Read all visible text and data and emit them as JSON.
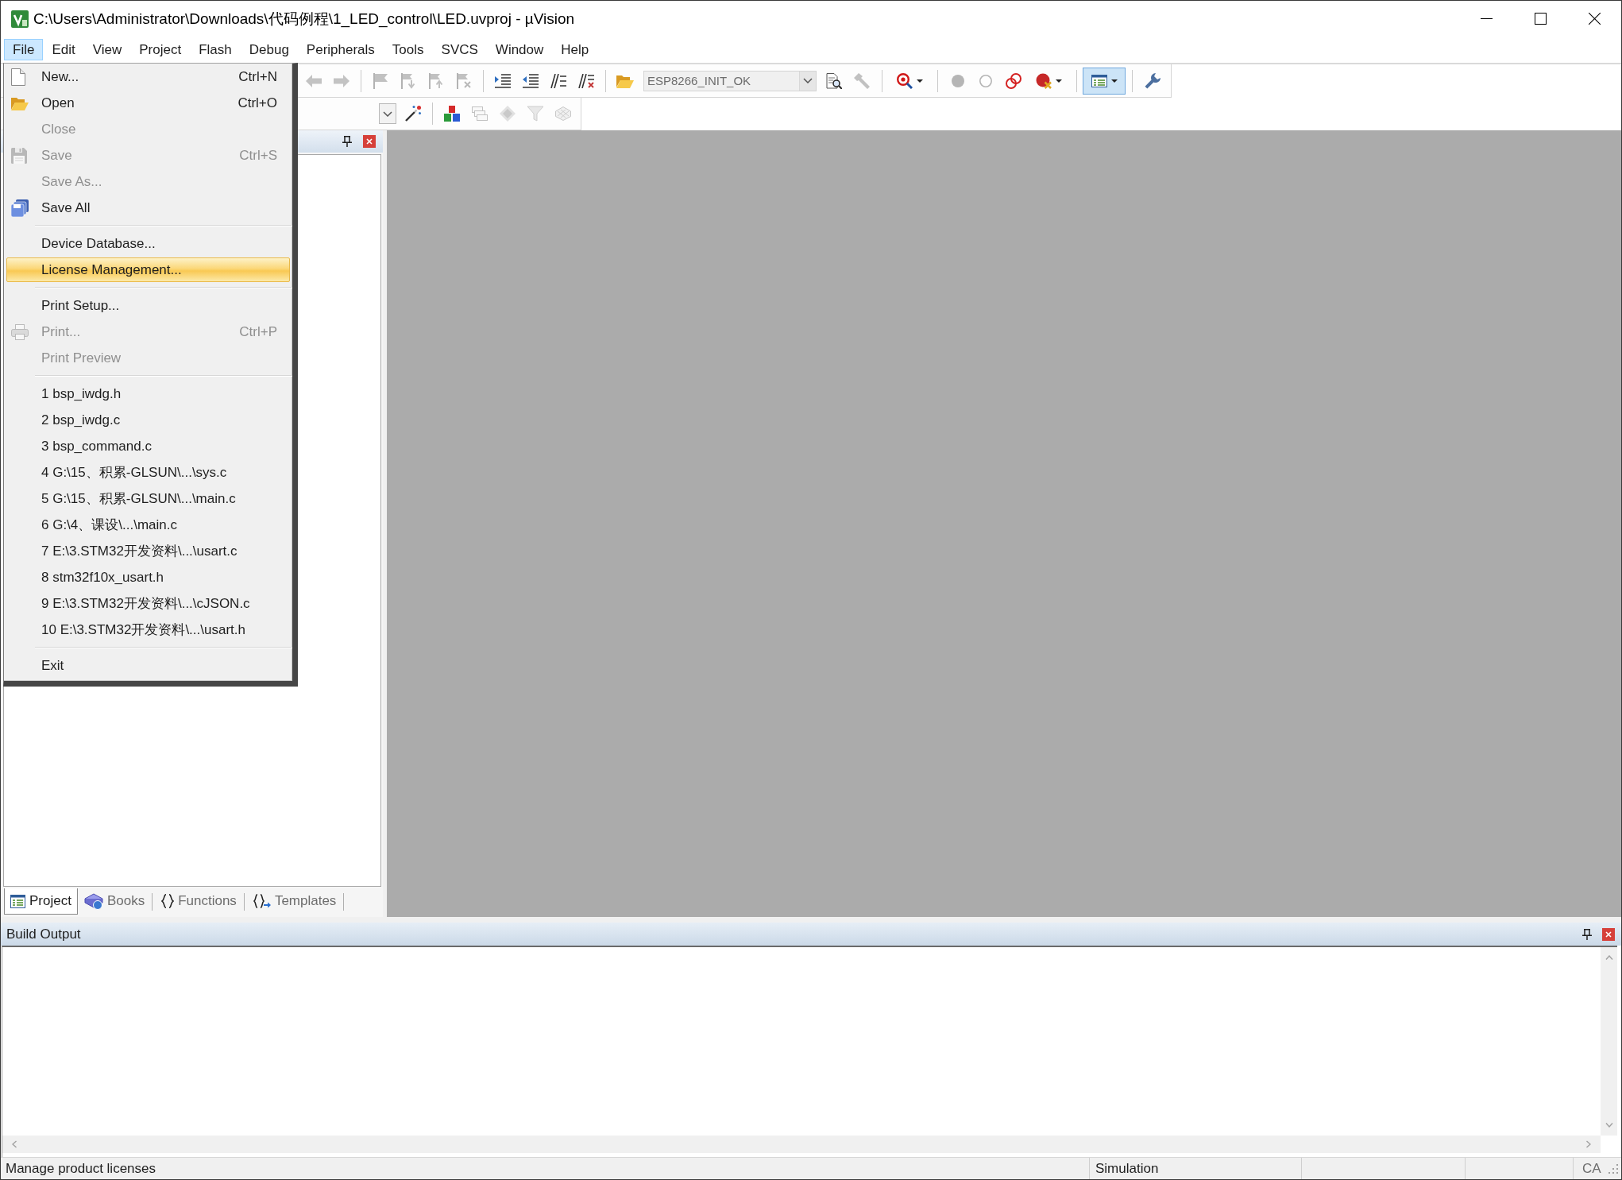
{
  "window": {
    "title": "C:\\Users\\Administrator\\Downloads\\代码例程\\1_LED_control\\LED.uvproj - µVision"
  },
  "menu_bar": [
    {
      "label": "File",
      "selected": true
    },
    {
      "label": "Edit",
      "selected": false
    },
    {
      "label": "View",
      "selected": false
    },
    {
      "label": "Project",
      "selected": false
    },
    {
      "label": "Flash",
      "selected": false
    },
    {
      "label": "Debug",
      "selected": false
    },
    {
      "label": "Peripherals",
      "selected": false
    },
    {
      "label": "Tools",
      "selected": false
    },
    {
      "label": "SVCS",
      "selected": false
    },
    {
      "label": "Window",
      "selected": false
    },
    {
      "label": "Help",
      "selected": false
    }
  ],
  "toolbar": {
    "buttons_1": [
      {
        "disabled": true,
        "on": false
      },
      {
        "disabled": true,
        "on": false
      },
      {
        "disabled": true,
        "on": false
      },
      {
        "disabled": true,
        "on": false
      },
      {
        "disabled": true,
        "on": false
      },
      {
        "disabled": true,
        "on": false
      },
      {
        "disabled": false,
        "on": false
      },
      {
        "disabled": false,
        "on": false
      },
      {
        "disabled": false,
        "on": false
      },
      {
        "disabled": false,
        "on": false
      },
      {
        "disabled": false,
        "on": false
      }
    ],
    "target": {
      "value": "ESP8266_INIT_OK",
      "disabled": true
    },
    "buttons_2": [
      {
        "disabled": false,
        "on": false
      },
      {
        "disabled": true,
        "on": false
      },
      {
        "disabled": false,
        "on": false
      },
      {
        "disabled": true,
        "on": false
      },
      {
        "disabled": true,
        "on": false
      },
      {
        "disabled": false,
        "on": false
      },
      {
        "disabled": false,
        "on": false
      },
      {
        "disabled": false,
        "on": true
      },
      {
        "disabled": false,
        "on": false
      }
    ],
    "buttons_3": [
      {
        "disabled": false,
        "on": false
      },
      {
        "disabled": false,
        "on": false
      },
      {
        "disabled": true,
        "on": false
      },
      {
        "disabled": true,
        "on": false
      },
      {
        "disabled": true,
        "on": false
      },
      {
        "disabled": true,
        "on": false
      }
    ]
  },
  "file_menu": {
    "groups": [
      [
        {
          "label": "New...",
          "shortcut": "Ctrl+N",
          "disabled": false,
          "selected": false
        },
        {
          "label": "Open",
          "shortcut": "Ctrl+O",
          "disabled": false,
          "selected": false
        },
        {
          "label": "Close",
          "disabled": true,
          "selected": false
        },
        {
          "label": "Save",
          "shortcut": "Ctrl+S",
          "disabled": true,
          "selected": false
        },
        {
          "label": "Save As...",
          "disabled": true,
          "selected": false
        },
        {
          "label": "Save All",
          "disabled": false,
          "selected": false
        }
      ],
      [
        {
          "label": "Device Database...",
          "disabled": false,
          "selected": false
        },
        {
          "label": "License Management...",
          "disabled": false,
          "selected": true
        }
      ],
      [
        {
          "label": "Print Setup...",
          "disabled": false,
          "selected": false
        },
        {
          "label": "Print...",
          "shortcut": "Ctrl+P",
          "disabled": true,
          "selected": false
        },
        {
          "label": "Print Preview",
          "disabled": true,
          "selected": false
        }
      ],
      [
        {
          "label": "1 bsp_iwdg.h",
          "disabled": false,
          "selected": false
        },
        {
          "label": "2 bsp_iwdg.c",
          "disabled": false,
          "selected": false
        },
        {
          "label": "3 bsp_command.c",
          "disabled": false,
          "selected": false
        },
        {
          "label": "4 G:\\15、积累-GLSUN\\...\\sys.c",
          "disabled": false,
          "selected": false
        },
        {
          "label": "5 G:\\15、积累-GLSUN\\...\\main.c",
          "disabled": false,
          "selected": false
        },
        {
          "label": "6 G:\\4、课设\\...\\main.c",
          "disabled": false,
          "selected": false
        },
        {
          "label": "7 E:\\3.STM32开发资料\\...\\usart.c",
          "disabled": false,
          "selected": false
        },
        {
          "label": "8 stm32f10x_usart.h",
          "disabled": false,
          "selected": false
        },
        {
          "label": "9 E:\\3.STM32开发资料\\...\\cJSON.c",
          "disabled": false,
          "selected": false
        },
        {
          "label": "10 E:\\3.STM32开发资料\\...\\usart.h",
          "disabled": false,
          "selected": false
        }
      ],
      [
        {
          "label": "Exit",
          "disabled": false,
          "selected": false
        }
      ]
    ]
  },
  "project_panel": {
    "tabs": [
      {
        "label": "Project",
        "selected": true
      },
      {
        "label": "Books",
        "selected": false
      },
      {
        "label": "Functions",
        "selected": false
      },
      {
        "label": "Templates",
        "selected": false
      }
    ]
  },
  "build_output": {
    "title": "Build Output"
  },
  "status_bar": {
    "message": "Manage product licenses",
    "mode": "Simulation",
    "caps": "CA"
  }
}
